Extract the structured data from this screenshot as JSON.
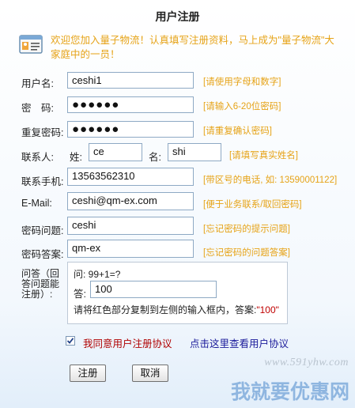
{
  "page_title": "用户注册",
  "welcome_text": "欢迎您加入量子物流！认真填写注册资料，马上成为\"量子物流\"大家庭中的一员！",
  "fields": {
    "username": {
      "label": "用户名:",
      "value": "ceshi1",
      "hint": "[请使用字母和数字]"
    },
    "password": {
      "label": "密　码:",
      "value": "●●●●●●",
      "hint": "[请输入6-20位密码]"
    },
    "password_confirm": {
      "label": "重复密码:",
      "value": "●●●●●●",
      "hint": "[请重复确认密码]"
    },
    "contact": {
      "label": "联系人:",
      "surname_label": "姓:",
      "surname_value": "ce",
      "given_label": "名:",
      "given_value": "shi",
      "hint": "[请填写真实姓名]"
    },
    "mobile": {
      "label": "联系手机:",
      "value": "13563562310",
      "hint": "[带区号的电话, 如: 13590001122]"
    },
    "email": {
      "label": "E-Mail:",
      "value": "ceshi@qm-ex.com",
      "hint": "[便于业务联系/取回密码]"
    },
    "question": {
      "label": "密码问题:",
      "value": "ceshi",
      "hint": "[忘记密码的提示问题]"
    },
    "answer": {
      "label": "密码答案:",
      "value": "qm-ex",
      "hint": "[忘记密码的问题答案]"
    }
  },
  "captcha": {
    "label": "问答（回答问题能注册）:",
    "question": "问: 99+1=?",
    "answer_label": "答:",
    "answer_value": "100",
    "instruction": "请将红色部分复制到左侧的输入框内，答案:",
    "answer_hint": "\"100\""
  },
  "agreement": {
    "checked": true,
    "label": "我同意用户注册协议",
    "link": "点击这里查看用户协议"
  },
  "buttons": {
    "submit": "注册",
    "cancel": "取消"
  },
  "watermark": {
    "url": "www.591yhw.com",
    "slogan": "我就要优惠网"
  },
  "colors": {
    "hint": "#e6a317",
    "link": "#1a1a9a",
    "agreement": "#b00000",
    "captcha_answer": "#c00000"
  }
}
